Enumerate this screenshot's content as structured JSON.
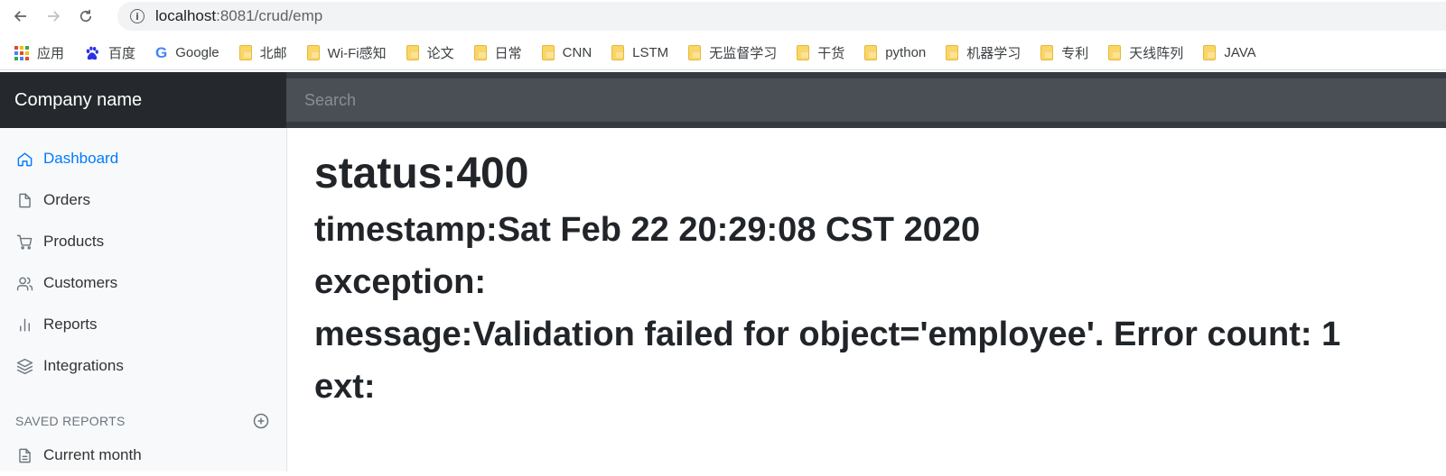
{
  "browser": {
    "url_host": "localhost",
    "url_path": ":8081/crud/emp",
    "bookmarks": [
      {
        "label": "应用",
        "icon": "apps-icon"
      },
      {
        "label": "百度",
        "icon": "baidu-icon"
      },
      {
        "label": "Google",
        "icon": "google-icon"
      },
      {
        "label": "北邮",
        "icon": "folder-icon"
      },
      {
        "label": "Wi-Fi感知",
        "icon": "folder-icon"
      },
      {
        "label": "论文",
        "icon": "folder-icon"
      },
      {
        "label": "日常",
        "icon": "folder-icon"
      },
      {
        "label": "CNN",
        "icon": "folder-icon"
      },
      {
        "label": "LSTM",
        "icon": "folder-icon"
      },
      {
        "label": "无监督学习",
        "icon": "folder-icon"
      },
      {
        "label": "干货",
        "icon": "folder-icon"
      },
      {
        "label": "python",
        "icon": "folder-icon"
      },
      {
        "label": "机器学习",
        "icon": "folder-icon"
      },
      {
        "label": "专利",
        "icon": "folder-icon"
      },
      {
        "label": "天线阵列",
        "icon": "folder-icon"
      },
      {
        "label": "JAVA",
        "icon": "folder-icon"
      }
    ]
  },
  "navbar": {
    "brand": "Company name",
    "search_placeholder": "Search"
  },
  "sidebar": {
    "items": [
      {
        "label": "Dashboard",
        "icon": "home-icon",
        "active": true
      },
      {
        "label": "Orders",
        "icon": "file-icon"
      },
      {
        "label": "Products",
        "icon": "shopping-cart-icon"
      },
      {
        "label": "Customers",
        "icon": "users-icon"
      },
      {
        "label": "Reports",
        "icon": "bar-chart-icon"
      },
      {
        "label": "Integrations",
        "icon": "layers-icon"
      }
    ],
    "saved_reports_heading": "SAVED REPORTS",
    "saved_reports": [
      {
        "label": "Current month",
        "icon": "file-text-icon"
      }
    ]
  },
  "error": {
    "status": "status:400",
    "timestamp": "timestamp:Sat Feb 22 20:29:08 CST 2020",
    "exception": "exception:",
    "message": "message:Validation failed for object='employee'. Error count: 1",
    "ext": "ext:"
  },
  "colors": {
    "accent": "#007bff",
    "navbar": "#343a40",
    "brand_bg": "#25292d"
  }
}
